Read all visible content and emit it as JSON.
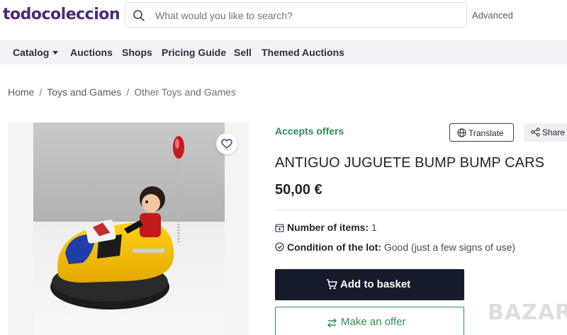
{
  "header": {
    "logo": "todocoleccion",
    "search_placeholder": "What would you like to search?",
    "advanced_label": "Advanced"
  },
  "nav": {
    "items": [
      "Catalog",
      "Auctions",
      "Shops",
      "Pricing Guide",
      "Sell",
      "Themed Auctions"
    ]
  },
  "breadcrumb": [
    "Home",
    "Toys and Games",
    "Other Toys and Games"
  ],
  "product": {
    "status": "Accepts offers",
    "translate_label": "Translate",
    "share_label": "Share",
    "title": "ANTIGUO JUGUETE BUMP BUMP CARS",
    "price": "50,00 €",
    "items_label": "Number of items:",
    "items_value": "1",
    "condition_label": "Condition of the lot:",
    "condition_value": "Good (just a few signs of use)",
    "basket_label": "Add to basket",
    "offer_label": "Make an offer"
  },
  "watermark": "BAZAR",
  "colors": {
    "brand": "#4a2a78",
    "accent_green": "#2e8b57",
    "primary_button": "#151b2d"
  },
  "icons": [
    "search-icon",
    "caret-down-icon",
    "heart-icon",
    "globe-icon",
    "share-icon",
    "box-icon",
    "check-circle-icon",
    "cart-icon",
    "swap-arrows-icon"
  ]
}
